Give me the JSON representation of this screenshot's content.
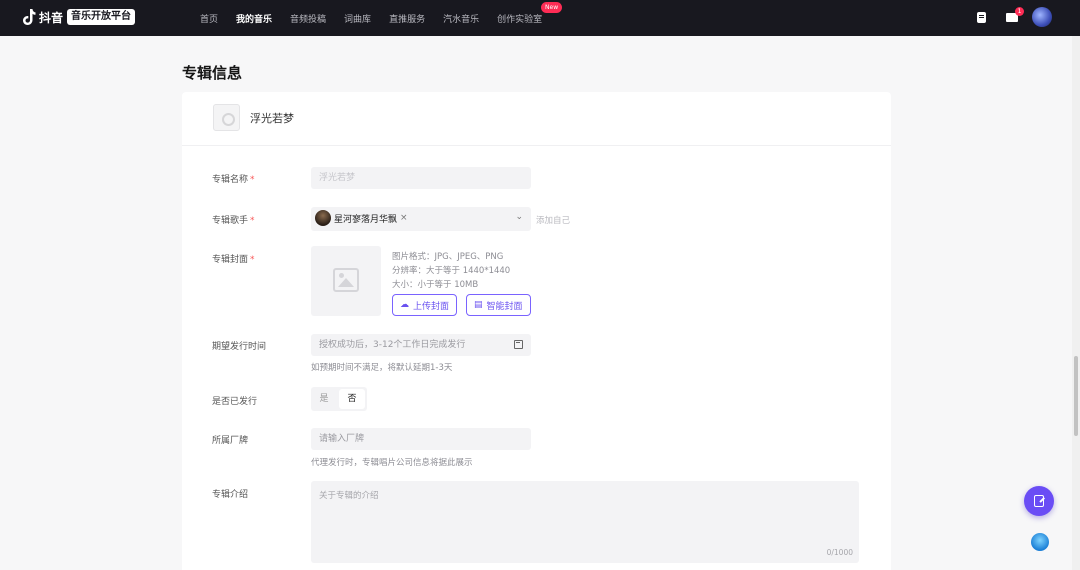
{
  "header": {
    "brand_name": "抖音",
    "brand_badge": "音乐开放平台",
    "nav": [
      {
        "label": "首页",
        "active": false
      },
      {
        "label": "我的音乐",
        "active": true
      },
      {
        "label": "音频投稿",
        "active": false
      },
      {
        "label": "词曲库",
        "active": false
      },
      {
        "label": "直推服务",
        "active": false
      },
      {
        "label": "汽水音乐",
        "active": false
      },
      {
        "label": "创作实验室",
        "active": false
      }
    ],
    "new_badge": "New",
    "mail_count": "1"
  },
  "page": {
    "title": "专辑信息",
    "album_name": "浮光若梦"
  },
  "form": {
    "album_name": {
      "label": "专辑名称",
      "required": "*",
      "value": "浮光若梦"
    },
    "album_artist": {
      "label": "专辑歌手",
      "required": "*",
      "artist": "星河寥落月华飘",
      "close": "×",
      "arrow": "⌄",
      "add_self": "添加自己"
    },
    "album_cover": {
      "label": "专辑封面",
      "required": "*",
      "format": "图片格式：JPG、JPEG、PNG",
      "resolution": "分辨率：大于等于 1440*1440",
      "size": "大小：小于等于 10MB",
      "upload_button": "上传封面",
      "select_button": "智能封面"
    },
    "release_time": {
      "label": "期望发行时间",
      "placeholder": "授权成功后，3-12个工作日完成发行",
      "hint": "如预期时间不满足，将默认延期1-3天"
    },
    "released": {
      "label": "是否已发行",
      "options": [
        "是",
        "否"
      ],
      "selected": "否"
    },
    "label_company": {
      "label": "所属厂牌",
      "placeholder": "请输入厂牌",
      "hint": "代理发行时，专辑唱片公司信息将据此展示"
    },
    "intro": {
      "label": "专辑介绍",
      "placeholder": "关于专辑的介绍",
      "count": "0/1000"
    }
  }
}
